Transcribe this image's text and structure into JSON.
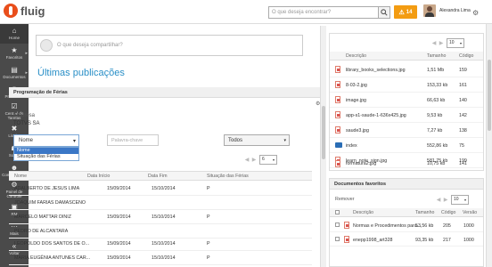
{
  "header": {
    "logo_text": "fluig",
    "search_placeholder": "O que deseja encontrar?",
    "alert_count": "14",
    "user_name": "Alexandra Lima"
  },
  "sidebar": {
    "items": [
      {
        "label": "Home",
        "icon": "home-icon",
        "glyph": "⌂"
      },
      {
        "label": "Favoritos",
        "icon": "star-icon",
        "glyph": "★"
      },
      {
        "label": "Documentos",
        "icon": "documents-icon",
        "glyph": "▤"
      },
      {
        "label": "Processos",
        "icon": "processes-icon",
        "glyph": "⚙"
      },
      {
        "label": "Central de Tarefas",
        "icon": "tasks-icon",
        "glyph": "☑"
      },
      {
        "label": "Lixeira",
        "icon": "trash-icon",
        "glyph": "🗑"
      },
      {
        "label": "Social",
        "icon": "social-icon",
        "glyph": "💬"
      },
      {
        "label": "Comunidades",
        "icon": "communities-icon",
        "glyph": "👥"
      },
      {
        "label": "Painel de Controle",
        "icon": "control-panel-icon",
        "glyph": "⚙"
      },
      {
        "label": "RM",
        "icon": "rm-icon",
        "glyph": "▣"
      },
      {
        "label": "Mais",
        "icon": "more-icon",
        "glyph": "···"
      },
      {
        "label": "Voltar",
        "icon": "back-icon",
        "glyph": "«"
      }
    ]
  },
  "main": {
    "share_placeholder": "O que deseja compartilhar?",
    "section_title": "Últimas publicações",
    "panel_title": "Programação de Férias",
    "empresa_label": "Empresa",
    "empresa_value": "TOTVS SA",
    "select_value": "Nome",
    "dropdown_options": [
      "Nome",
      "Situação das Férias"
    ],
    "keyword_placeholder": "Palavra-chave",
    "filter_value": "Todos",
    "page_size": "6",
    "columns": [
      "Nome",
      "Data Início",
      "Data Fim",
      "Situação das Férias"
    ],
    "rows": [
      {
        "nome": "ADALBERTO DE JESUS LIMA",
        "inicio": "15/09/2014",
        "fim": "15/10/2014",
        "situacao": "P"
      },
      {
        "nome": "JOAQUIM FARIAS DAMASCENO",
        "inicio": "",
        "fim": "",
        "situacao": ""
      },
      {
        "nome": "MARCELO MATTAR DINIZ",
        "inicio": "15/09/2014",
        "fim": "15/10/2014",
        "situacao": "P"
      },
      {
        "nome": "PEDRO DE ALCANTARA",
        "inicio": "",
        "fim": "",
        "situacao": ""
      },
      {
        "nome": "LEOPOLDO DOS SANTOS DE O...",
        "inicio": "15/09/2014",
        "fim": "15/10/2014",
        "situacao": "P"
      },
      {
        "nome": "MARIA EUGÊNIA ANTUNES CAR...",
        "inicio": "15/09/2014",
        "fim": "15/10/2014",
        "situacao": "P"
      }
    ]
  },
  "docs": {
    "page_size": "10",
    "columns": [
      "Descrição",
      "Tamanho",
      "Código"
    ],
    "rows": [
      {
        "desc": "library_books_selections.jpg",
        "size": "1,51 Mb",
        "code": "159",
        "type": "image"
      },
      {
        "desc": "8-03-2.jpg",
        "size": "153,33 kb",
        "code": "161",
        "type": "image"
      },
      {
        "desc": "image.jpg",
        "size": "66,63 kb",
        "code": "140",
        "type": "image"
      },
      {
        "desc": "app-s1-saude-1-636x425.jpg",
        "size": "9,53 kb",
        "code": "142",
        "type": "image"
      },
      {
        "desc": "saude3.jpg",
        "size": "7,27 kb",
        "code": "138",
        "type": "image"
      },
      {
        "desc": "index",
        "size": "552,86 kb",
        "code": "75",
        "type": "folder"
      },
      {
        "desc": "learn_note_sign.jpg",
        "size": "581,75 kb",
        "code": "199",
        "type": "image"
      },
      {
        "desc": "formatura2.jpg",
        "size": "10,75 kb",
        "code": "141",
        "type": "image"
      }
    ]
  },
  "favorites": {
    "title": "Documentos favoritos",
    "remove_label": "Remover",
    "page_size": "10",
    "columns": [
      "Descrição",
      "Tamanho",
      "Código",
      "Versão"
    ],
    "rows": [
      {
        "desc": "Normas e Procedimentos para...",
        "size": "53,56 kb",
        "code": "205",
        "version": "1000"
      },
      {
        "desc": "enepp1998_art328",
        "size": "93,35 kb",
        "code": "217",
        "version": "1000"
      }
    ]
  }
}
